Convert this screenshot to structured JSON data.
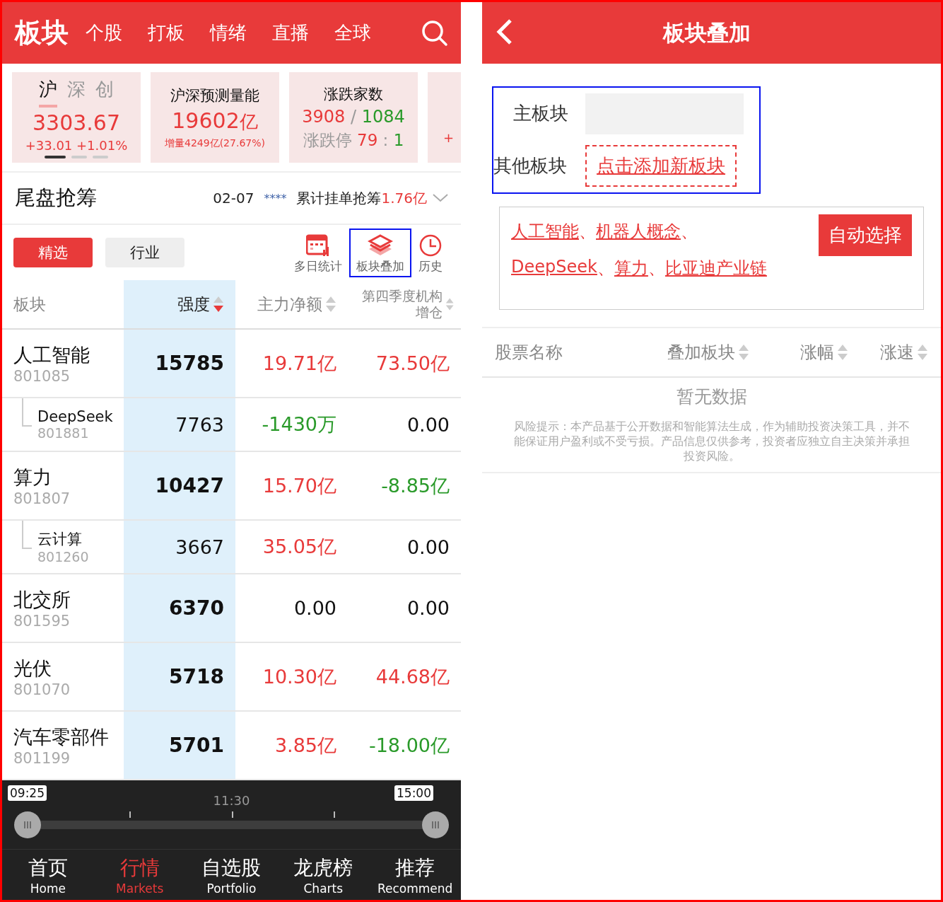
{
  "left": {
    "header": {
      "tabs": [
        {
          "label": "板块",
          "selected": true
        },
        {
          "label": "个股",
          "selected": false
        },
        {
          "label": "打板",
          "selected": false
        },
        {
          "label": "情绪",
          "selected": false
        },
        {
          "label": "直播",
          "selected": false
        },
        {
          "label": "全球",
          "selected": false
        }
      ]
    },
    "cards": [
      {
        "kind": "index",
        "tabs": [
          {
            "label": "沪",
            "selected": true
          },
          {
            "label": "深",
            "selected": false
          },
          {
            "label": "创",
            "selected": false
          }
        ],
        "value": "3303.67",
        "change": "+33.01 +1.01%",
        "pages": [
          {
            "selected": true
          },
          {
            "selected": false
          },
          {
            "selected": false
          }
        ]
      },
      {
        "kind": "volume",
        "title": "沪深预测量能",
        "value": "19602",
        "unit": "亿",
        "delta_label": "增量",
        "delta": "4249亿(27.67%)"
      },
      {
        "kind": "breadth",
        "title": "涨跌家数",
        "up": "3908",
        "sep": "/",
        "down": "1084",
        "limit_label": "涨跌停",
        "limit_up": "79",
        "colon": ":",
        "limit_down": "1"
      },
      {
        "kind": "partial",
        "change": "+"
      }
    ],
    "section": {
      "title": "尾盘抢筹",
      "date": "02-07",
      "stars": "****",
      "label": "累计挂单抢筹",
      "amount": "1.76亿"
    },
    "filters": [
      {
        "label": "精选",
        "selected": true
      },
      {
        "label": "行业",
        "selected": false
      }
    ],
    "tools": [
      {
        "kind": "calendar",
        "label": "多日统计",
        "highlighted": false
      },
      {
        "kind": "layers",
        "label": "板块叠加",
        "highlighted": true
      },
      {
        "kind": "clock",
        "label": "历史",
        "highlighted": false
      }
    ],
    "table": {
      "columns": [
        {
          "label": "板块",
          "sortable": false,
          "sorted": false
        },
        {
          "label": "强度",
          "sortable": true,
          "sorted": true
        },
        {
          "label": "主力净额",
          "sortable": true,
          "sorted": false
        },
        {
          "label": "第四季度机构增仓",
          "sortable": true,
          "sorted": false
        }
      ],
      "rows": [
        {
          "name": "人工智能",
          "code": "801085",
          "strength": "15785",
          "net": {
            "text": "19.71亿",
            "color": "#e83a3a"
          },
          "q4": {
            "text": "73.50亿",
            "color": "#e83a3a"
          },
          "children": [
            {
              "name": "DeepSeek",
              "code": "801881",
              "strength": "7763",
              "net": {
                "text": "-1430万",
                "color": "#2a9a2a"
              },
              "q4": {
                "text": "0.00",
                "color": "#111111"
              }
            }
          ]
        },
        {
          "name": "算力",
          "code": "801807",
          "strength": "10427",
          "net": {
            "text": "15.70亿",
            "color": "#e83a3a"
          },
          "q4": {
            "text": "-8.85亿",
            "color": "#2a9a2a"
          },
          "children": [
            {
              "name": "云计算",
              "code": "801260",
              "strength": "3667",
              "net": {
                "text": "35.05亿",
                "color": "#e83a3a"
              },
              "q4": {
                "text": "0.00",
                "color": "#111111"
              }
            }
          ]
        },
        {
          "name": "北交所",
          "code": "801595",
          "strength": "6370",
          "net": {
            "text": "0.00",
            "color": "#111111"
          },
          "q4": {
            "text": "0.00",
            "color": "#111111"
          }
        },
        {
          "name": "光伏",
          "code": "801070",
          "strength": "5718",
          "net": {
            "text": "10.30亿",
            "color": "#e83a3a"
          },
          "q4": {
            "text": "44.68亿",
            "color": "#e83a3a"
          }
        },
        {
          "name": "汽车零部件",
          "code": "801199",
          "strength": "5701",
          "net": {
            "text": "3.85亿",
            "color": "#e83a3a"
          },
          "q4": {
            "text": "-18.00亿",
            "color": "#2a9a2a"
          }
        }
      ]
    },
    "timeline": {
      "axis_label": "11:30",
      "start": {
        "label": "09:25",
        "level": 0
      },
      "end": {
        "label": "15:00",
        "level": 1
      }
    },
    "nav": [
      {
        "label": "首页",
        "sub": "Home",
        "selected": false
      },
      {
        "label": "行情",
        "sub": "Markets",
        "selected": true
      },
      {
        "label": "自选股",
        "sub": "Portfolio",
        "selected": false
      },
      {
        "label": "龙虎榜",
        "sub": "Charts",
        "selected": false
      },
      {
        "label": "推荐",
        "sub": "Recommend",
        "selected": false
      }
    ]
  },
  "right": {
    "title": "板块叠加",
    "main_label": "主板块",
    "other_label": "其他板块",
    "add_link": "点击添加新板块",
    "chosen_lines": [
      [
        "人工智能",
        "机器人概念"
      ],
      [
        "DeepSeek",
        "算力",
        "比亚迪产业链"
      ]
    ],
    "separator": "、",
    "auto_button": "自动选择",
    "columns": [
      {
        "label": "股票名称",
        "sortable": false,
        "sorted": false
      },
      {
        "label": "叠加板块",
        "sortable": true,
        "sorted": false
      },
      {
        "label": "涨幅",
        "sortable": true,
        "sorted": false
      },
      {
        "label": "涨速",
        "sortable": true,
        "sorted": false
      }
    ],
    "empty": "暂无数据",
    "disclaimer": "风险提示：本产品基于公开数据和智能算法生成，作为辅助投资决策工具，并不能保证用户盈利或不受亏损。产品信息仅供参考，投资者应独立自主决策并承担投资风险。"
  }
}
